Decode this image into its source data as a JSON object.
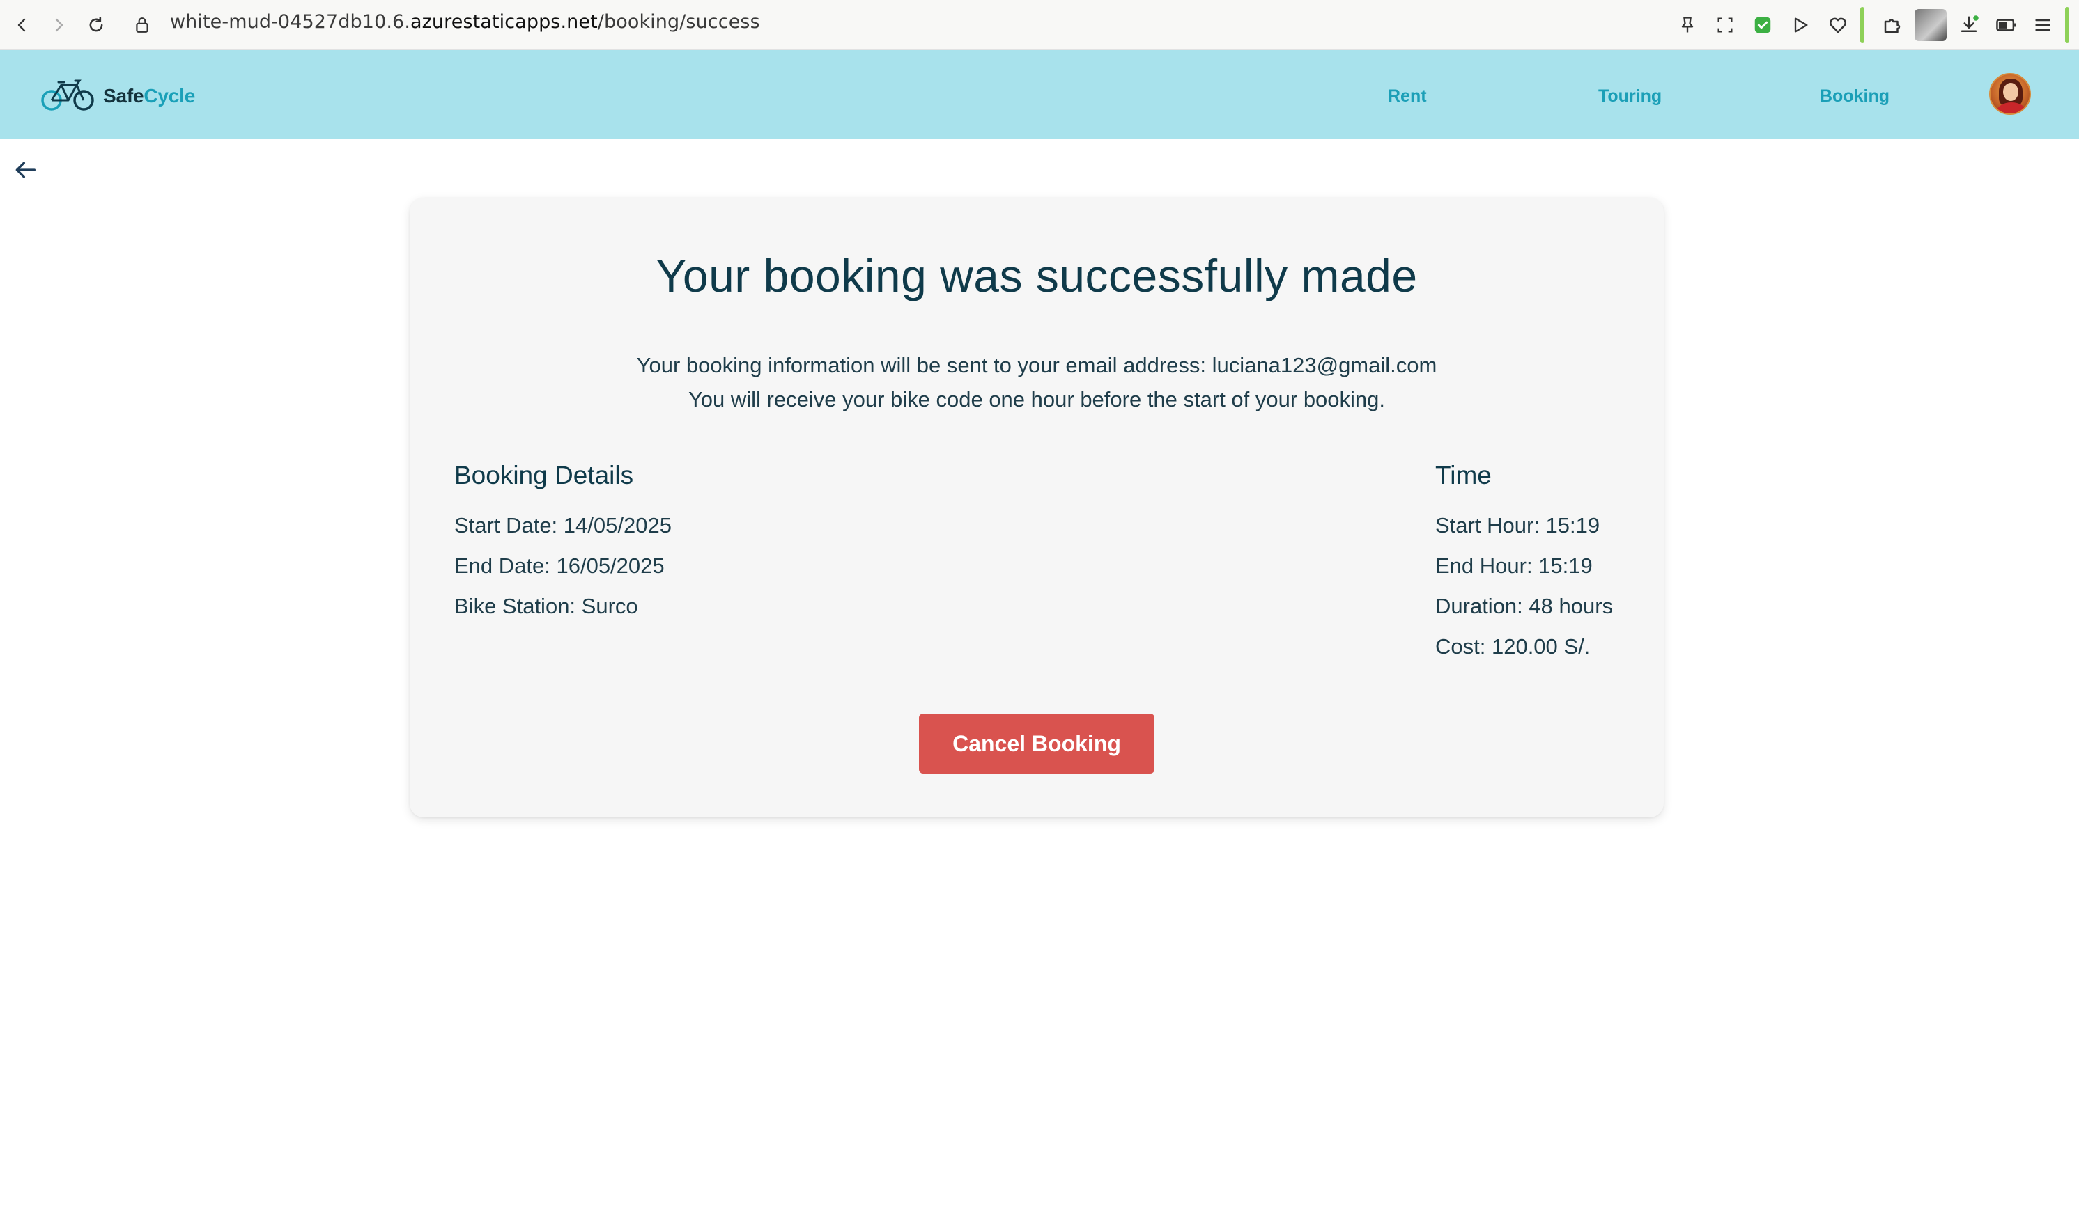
{
  "browser": {
    "url_prefix": "white-mud-04527db10.6.",
    "url_host": "azurestaticapps.net",
    "url_path": "/booking/success"
  },
  "app": {
    "logo_text_main": "Safe",
    "logo_text_accent": "Cycle",
    "nav": {
      "rent": "Rent",
      "touring": "Touring",
      "booking": "Booking"
    }
  },
  "success": {
    "title": "Your booking was successfully made",
    "info_line1": "Your booking information will be sent to your email address: luciana123@gmail.com",
    "info_line2": "You will receive your bike code one hour before the start of your booking."
  },
  "details": {
    "heading": "Booking Details",
    "start_date": "Start Date: 14/05/2025",
    "end_date": "End Date: 16/05/2025",
    "station": "Bike Station: Surco"
  },
  "time": {
    "heading": "Time",
    "start_hour": "Start Hour: 15:19",
    "end_hour": "End Hour: 15:19",
    "duration": "Duration: 48 hours",
    "cost": "Cost: 120.00 S/."
  },
  "actions": {
    "cancel_label": "Cancel Booking"
  },
  "colors": {
    "navbar": "#a8e2ec",
    "nav_link": "#1b9fb7",
    "title": "#0f3a4a",
    "cancel_button": "#d9534f",
    "card_bg": "#f6f6f6"
  },
  "icons": [
    "back-browser-icon",
    "forward-browser-icon",
    "reload-icon",
    "lock-icon",
    "pin-icon",
    "screenshot-icon",
    "shield-check-icon",
    "play-icon",
    "heart-icon",
    "puzzle-icon",
    "profile-icon",
    "download-icon",
    "battery-icon",
    "menu-icon",
    "bicycle-logo-icon",
    "back-arrow-icon"
  ]
}
